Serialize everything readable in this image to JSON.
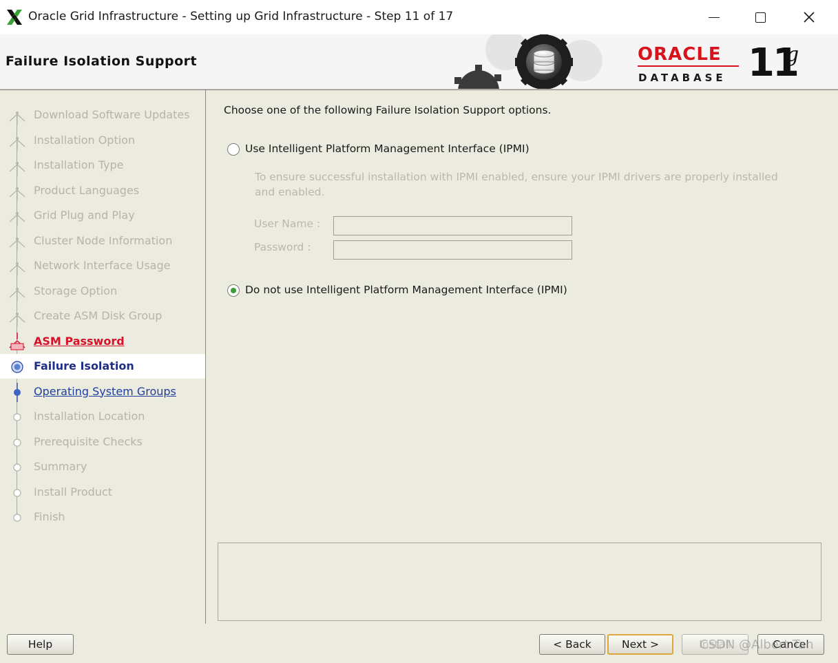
{
  "window": {
    "title": "Oracle Grid Infrastructure - Setting up Grid Infrastructure - Step 11 of 17",
    "minimize_glyph": "—",
    "maximize_glyph": "☐",
    "close_glyph": "✕"
  },
  "banner": {
    "page_title": "Failure Isolation Support",
    "brand_word": "ORACLE",
    "brand_sub": "DATABASE",
    "version_number": "11",
    "version_letter": "g"
  },
  "steps": [
    {
      "label": "Download Software Updates",
      "state": "done"
    },
    {
      "label": "Installation Option",
      "state": "done"
    },
    {
      "label": "Installation Type",
      "state": "done"
    },
    {
      "label": "Product Languages",
      "state": "done"
    },
    {
      "label": "Grid Plug and Play",
      "state": "done"
    },
    {
      "label": "Cluster Node Information",
      "state": "done"
    },
    {
      "label": "Network Interface Usage",
      "state": "done"
    },
    {
      "label": "Storage Option",
      "state": "done"
    },
    {
      "label": "Create ASM Disk Group",
      "state": "done"
    },
    {
      "label": "ASM Password",
      "state": "error"
    },
    {
      "label": "Failure Isolation",
      "state": "active"
    },
    {
      "label": "Operating System Groups",
      "state": "next"
    },
    {
      "label": "Installation Location",
      "state": "pending"
    },
    {
      "label": "Prerequisite Checks",
      "state": "pending"
    },
    {
      "label": "Summary",
      "state": "pending"
    },
    {
      "label": "Install Product",
      "state": "pending"
    },
    {
      "label": "Finish",
      "state": "pending"
    }
  ],
  "main": {
    "intro": "Choose one of the following Failure Isolation Support options.",
    "option_ipmi": {
      "label": "Use Intelligent Platform Management Interface (IPMI)",
      "selected": false
    },
    "ipmi_note_line1": "To ensure successful installation with IPMI enabled, ensure your IPMI drivers are properly installed",
    "ipmi_note_line2": "and enabled.",
    "user_name_label": "User Name :",
    "user_name_value": "",
    "password_label": "Password :",
    "password_value": "",
    "option_no_ipmi": {
      "label": "Do not use Intelligent Platform Management Interface (IPMI)",
      "selected": true
    },
    "message_text": ""
  },
  "footer": {
    "help": "Help",
    "back": "< Back",
    "next": "Next >",
    "install": "Install",
    "cancel": "Cancel",
    "watermark": "CSDN @Albert Tan"
  },
  "colors": {
    "panel_bg": "#ecebe0",
    "active_step": "#1f2f88",
    "error_step": "#d6112a",
    "oracle_red": "#d8131b",
    "focus_border": "#e0a63b"
  }
}
